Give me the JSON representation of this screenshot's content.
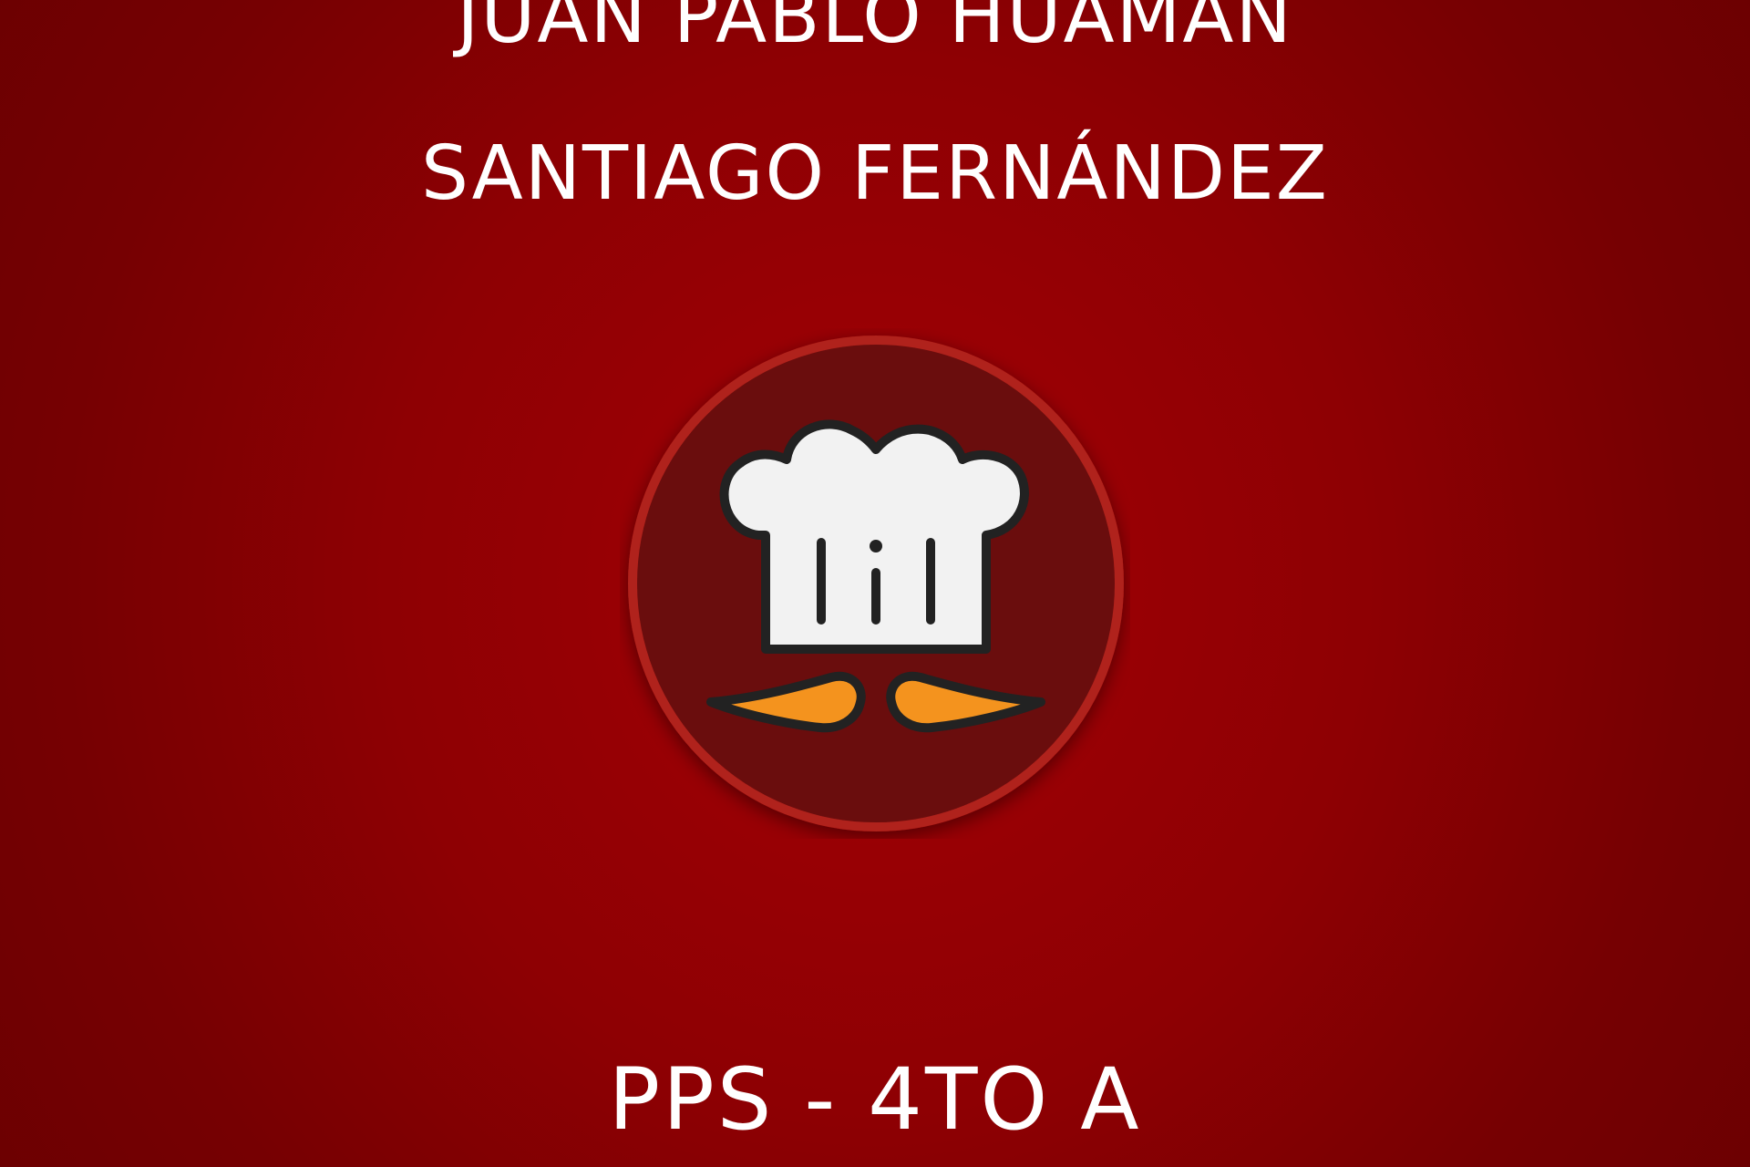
{
  "names": [
    "JUAN PABLO HUAMAN",
    "SANTIAGO FERNÁNDEZ"
  ],
  "footer": "PPS - 4TO A",
  "logo": {
    "icon": "chef-hat-mustache-icon"
  },
  "colors": {
    "background": "#8e0003",
    "badge_fill": "#6a0d0d",
    "badge_ring": "#b0201a",
    "hat": "#f2f2f2",
    "mustache": "#f4931e",
    "outline": "#222222",
    "text": "#ffffff"
  }
}
